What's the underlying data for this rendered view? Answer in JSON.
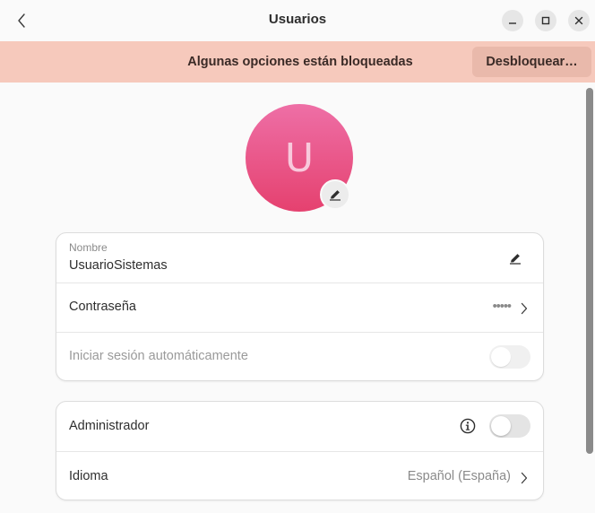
{
  "window": {
    "title": "Usuarios"
  },
  "banner": {
    "message": "Algunas opciones están bloqueadas",
    "unlock_label": "Desbloquear…"
  },
  "avatar": {
    "initial": "U",
    "gradient_top": "#ee6fa6",
    "gradient_bottom": "#e5416f"
  },
  "account": {
    "name_caption": "Nombre",
    "name_value": "UsuarioSistemas",
    "password_label": "Contraseña",
    "password_value": "•••••",
    "autologin_label": "Iniciar sesión automáticamente",
    "autologin_enabled": false
  },
  "privileges": {
    "admin_label": "Administrador",
    "admin_enabled": false,
    "language_label": "Idioma",
    "language_value": "Español (España)"
  },
  "icons": {
    "back": "chevron-left-icon",
    "minimize": "minimize-icon",
    "maximize": "maximize-icon",
    "close": "close-icon",
    "edit": "pencil-icon",
    "info": "info-icon",
    "chevron": "chevron-right-icon"
  },
  "colors": {
    "banner_bg": "#f6c9bc",
    "unlock_button_bg": "#e9b9ab"
  }
}
